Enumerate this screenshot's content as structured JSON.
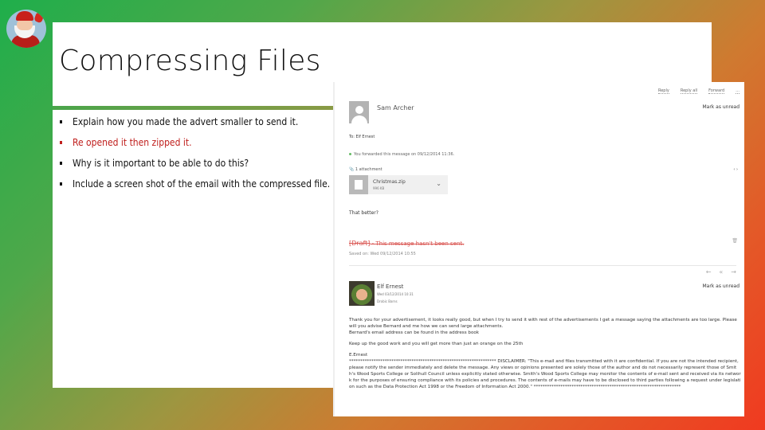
{
  "slide": {
    "title": "Compressing Files",
    "bullets": [
      {
        "text": "Explain how you made the advert smaller to send it.",
        "color": "#111111"
      },
      {
        "text": "Re opened it then zipped it.",
        "color": "#c0201e"
      },
      {
        "text": "Why is it important to be able to do this?",
        "color": "#111111"
      },
      {
        "text": "Include a screen shot of the email with the compressed file.",
        "color": "#111111"
      }
    ],
    "decoration_icon": "santa-icon"
  },
  "email": {
    "toolbar": [
      "Reply",
      "Reply all",
      "Forward",
      "..."
    ],
    "message1": {
      "sender": "Sam Archer",
      "mark_unread": "Mark as unread",
      "to": "To: Elf Ernest",
      "forwarded_note": "You forwarded this message on 09/12/2014 11:36.",
      "attachments_label": "1 attachment",
      "attachment_actions": "‹ ›",
      "attachment": {
        "name": "Christmas.zip",
        "size": "996 KB"
      },
      "body": "That better?"
    },
    "draft": {
      "tag": "[Draft]",
      "text": "This message hasn't been sent.",
      "saved": "Saved on: Wed 09/12/2014 10:55"
    },
    "nav": [
      "←",
      "«",
      "→"
    ],
    "message2": {
      "sender": "Elf Ernest",
      "mark_unread": "Mark as unread",
      "date": "Wed 03/12/2014 10:31",
      "to": "Drobic Barns",
      "body": [
        "Thank you for your advertisement, it looks really good, but when I try to send it with rest of the advertisements I get a message saying the attachments are too large. Please will you advise Bernard and me how we can send large attachments.",
        "Bernard's email address can be found in the address book",
        "Keep up the good work and you will get more than just an orange on the 25th",
        "E.Ernest"
      ],
      "disclaimer": "****************************************************************** DISCLAIMER: \"This e-mail and files transmitted with it are confidential. If you are not the intended recipient, please notify the sender immediately and delete the message. Any views or opinions presented are solely those of the author and do not necessarily represent those of Smith's Wood Sports College or Solihull Council unless explicitly stated otherwise. Smith's Wood Sports College may monitor the contents of e-mail sent and received via its network for the purposes of ensuring compliance with its policies and procedures. The contents of e-mails may have to be disclosed to third parties following a request under legislation such as the Data Protection Act 1998 or the Freedom of Information Act 2000.\" ******************************************************************"
    }
  }
}
